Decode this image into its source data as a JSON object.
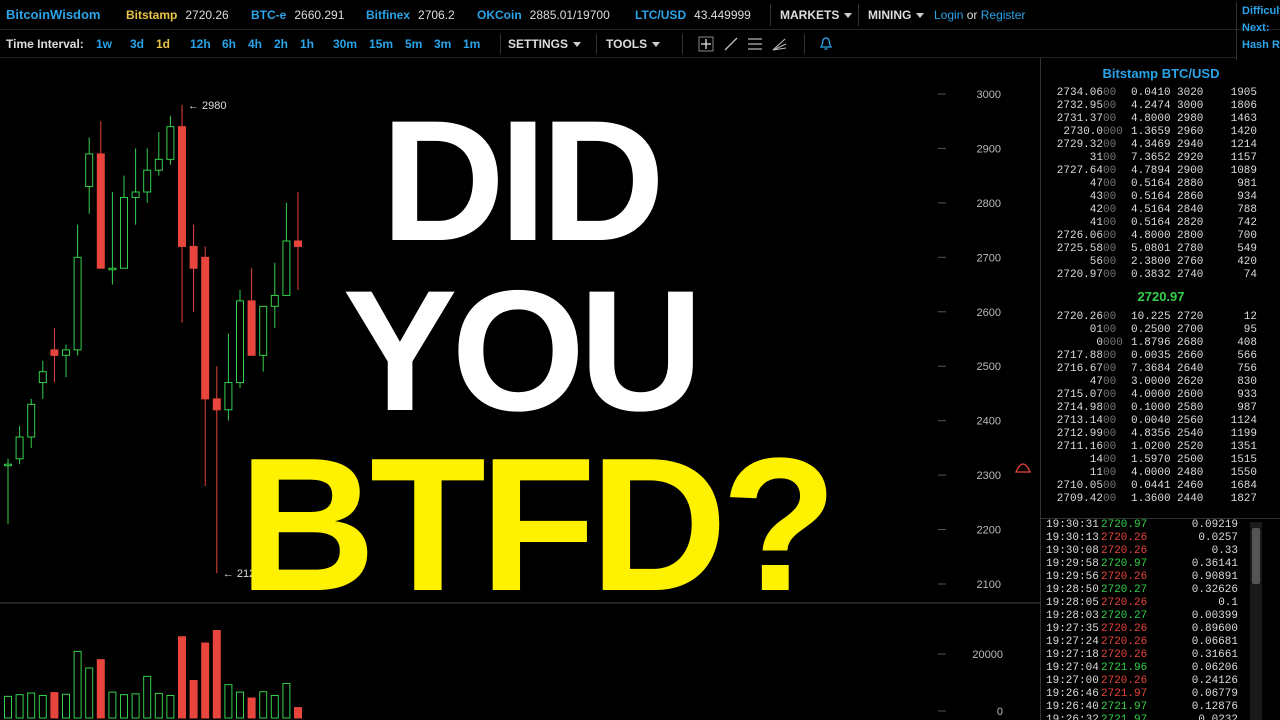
{
  "brand": "BitcoinWisdom",
  "tickers": [
    {
      "name": "Bitstamp",
      "price": "2720.26",
      "active": true
    },
    {
      "name": "BTC-e",
      "price": "2660.291"
    },
    {
      "name": "Bitfinex",
      "price": "2706.2"
    },
    {
      "name": "OKCoin",
      "price": "2885.01/19700"
    },
    {
      "name": "LTC/USD",
      "price": "43.449999"
    }
  ],
  "menus": {
    "markets": "MARKETS",
    "mining": "MINING"
  },
  "auth": {
    "login": "Login",
    "or": "or",
    "register": "Register"
  },
  "difficulty_box": [
    "Difficulty",
    "Next:",
    "Hash Rate"
  ],
  "toolbar": {
    "time_interval_label": "Time Interval:",
    "intervals": [
      "1w",
      "3d",
      "1d",
      "12h",
      "6h",
      "4h",
      "2h",
      "1h",
      "30m",
      "15m",
      "5m",
      "3m",
      "1m"
    ],
    "active_interval": "1d",
    "settings": "SETTINGS",
    "tools": "TOOLS"
  },
  "chart_data": {
    "type": "candlestick",
    "y_axis_ticks": [
      3000,
      2900,
      2800,
      2700,
      2600,
      2500,
      2400,
      2300,
      2200,
      2100
    ],
    "ylim": [
      2050,
      3040
    ],
    "annotations": [
      {
        "label": "← 2980",
        "value": 2980
      },
      {
        "label": "← 2120",
        "value": 2120
      }
    ],
    "candles": [
      {
        "o": 2320,
        "h": 2330,
        "l": 2210,
        "c": 2320
      },
      {
        "o": 2330,
        "h": 2390,
        "l": 2320,
        "c": 2370
      },
      {
        "o": 2370,
        "h": 2440,
        "l": 2350,
        "c": 2430
      },
      {
        "o": 2470,
        "h": 2510,
        "l": 2440,
        "c": 2490
      },
      {
        "o": 2530,
        "h": 2570,
        "l": 2470,
        "c": 2520
      },
      {
        "o": 2520,
        "h": 2540,
        "l": 2480,
        "c": 2530
      },
      {
        "o": 2530,
        "h": 2760,
        "l": 2520,
        "c": 2700
      },
      {
        "o": 2830,
        "h": 2920,
        "l": 2780,
        "c": 2890
      },
      {
        "o": 2890,
        "h": 2950,
        "l": 2690,
        "c": 2680
      },
      {
        "o": 2680,
        "h": 2820,
        "l": 2650,
        "c": 2680
      },
      {
        "o": 2680,
        "h": 2850,
        "l": 2680,
        "c": 2810
      },
      {
        "o": 2810,
        "h": 2900,
        "l": 2760,
        "c": 2820
      },
      {
        "o": 2820,
        "h": 2900,
        "l": 2800,
        "c": 2860
      },
      {
        "o": 2860,
        "h": 2930,
        "l": 2850,
        "c": 2880
      },
      {
        "o": 2880,
        "h": 2960,
        "l": 2870,
        "c": 2940
      },
      {
        "o": 2940,
        "h": 2980,
        "l": 2580,
        "c": 2720
      },
      {
        "o": 2720,
        "h": 2760,
        "l": 2600,
        "c": 2680
      },
      {
        "o": 2700,
        "h": 2720,
        "l": 2280,
        "c": 2440
      },
      {
        "o": 2440,
        "h": 2500,
        "l": 2120,
        "c": 2420
      },
      {
        "o": 2420,
        "h": 2560,
        "l": 2400,
        "c": 2470
      },
      {
        "o": 2470,
        "h": 2640,
        "l": 2460,
        "c": 2620
      },
      {
        "o": 2620,
        "h": 2680,
        "l": 2540,
        "c": 2520
      },
      {
        "o": 2520,
        "h": 2600,
        "l": 2490,
        "c": 2610
      },
      {
        "o": 2610,
        "h": 2690,
        "l": 2570,
        "c": 2630
      },
      {
        "o": 2630,
        "h": 2800,
        "l": 2630,
        "c": 2730
      },
      {
        "o": 2730,
        "h": 2820,
        "l": 2640,
        "c": 2720
      }
    ],
    "volume_axis_ticks": [
      20000,
      0
    ],
    "volume": [
      {
        "v": 5200,
        "up": true
      },
      {
        "v": 5600,
        "up": true
      },
      {
        "v": 6000,
        "up": true
      },
      {
        "v": 5400,
        "up": true
      },
      {
        "v": 6100,
        "up": false
      },
      {
        "v": 5700,
        "up": true
      },
      {
        "v": 16000,
        "up": true
      },
      {
        "v": 12000,
        "up": true
      },
      {
        "v": 14000,
        "up": false
      },
      {
        "v": 6200,
        "up": true
      },
      {
        "v": 5600,
        "up": true
      },
      {
        "v": 5800,
        "up": true
      },
      {
        "v": 10000,
        "up": true
      },
      {
        "v": 5900,
        "up": true
      },
      {
        "v": 5400,
        "up": true
      },
      {
        "v": 19500,
        "up": false
      },
      {
        "v": 9000,
        "up": false
      },
      {
        "v": 18000,
        "up": false
      },
      {
        "v": 21000,
        "up": false
      },
      {
        "v": 8000,
        "up": true
      },
      {
        "v": 6200,
        "up": true
      },
      {
        "v": 4800,
        "up": false
      },
      {
        "v": 6300,
        "up": true
      },
      {
        "v": 5400,
        "up": true
      },
      {
        "v": 8300,
        "up": true
      },
      {
        "v": 2500,
        "up": false
      }
    ],
    "vlim": [
      0,
      24000
    ]
  },
  "overlay": {
    "line1": "DID",
    "line2": "YOU",
    "line3": "BTFD?"
  },
  "orderbook": {
    "title": "Bitstamp BTC/USD",
    "last_price": "2720.97",
    "asks": [
      [
        "2734.06",
        "00",
        "0.0410",
        "3020",
        "1905"
      ],
      [
        "2732.95",
        "00",
        "4.2474",
        "3000",
        "1806"
      ],
      [
        "2731.37",
        "00",
        "4.8000",
        "2980",
        "1463"
      ],
      [
        "2730.0",
        "000",
        "1.3659",
        "2960",
        "1420"
      ],
      [
        "2729.32",
        "00",
        "4.3469",
        "2940",
        "1214"
      ],
      [
        "31",
        "00",
        "7.3652",
        "2920",
        "1157"
      ],
      [
        "2727.64",
        "00",
        "4.7894",
        "2900",
        "1089"
      ],
      [
        "47",
        "00",
        "0.5164",
        "2880",
        "981"
      ],
      [
        "43",
        "00",
        "0.5164",
        "2860",
        "934"
      ],
      [
        "42",
        "00",
        "4.5164",
        "2840",
        "788"
      ],
      [
        "41",
        "00",
        "0.5164",
        "2820",
        "742"
      ],
      [
        "2726.06",
        "00",
        "4.8000",
        "2800",
        "700"
      ],
      [
        "2725.58",
        "00",
        "5.0801",
        "2780",
        "549"
      ],
      [
        "56",
        "00",
        "2.3800",
        "2760",
        "420"
      ],
      [
        "2720.97",
        "00",
        "0.3832",
        "2740",
        "74"
      ]
    ],
    "bids": [
      [
        "2720.26",
        "00",
        "10.225",
        "2720",
        "12"
      ],
      [
        "01",
        "00",
        "0.2500",
        "2700",
        "95"
      ],
      [
        "0",
        "000",
        "1.8796",
        "2680",
        "408"
      ],
      [
        "2717.88",
        "00",
        "0.0035",
        "2660",
        "566"
      ],
      [
        "2716.67",
        "00",
        "7.3684",
        "2640",
        "756"
      ],
      [
        "47",
        "00",
        "3.0000",
        "2620",
        "830"
      ],
      [
        "2715.07",
        "00",
        "4.0000",
        "2600",
        "933"
      ],
      [
        "2714.98",
        "00",
        "0.1000",
        "2580",
        "987"
      ],
      [
        "2713.14",
        "00",
        "0.0040",
        "2560",
        "1124"
      ],
      [
        "2712.99",
        "00",
        "4.8356",
        "2540",
        "1199"
      ],
      [
        "2711.16",
        "00",
        "1.0200",
        "2520",
        "1351"
      ],
      [
        "14",
        "00",
        "1.5970",
        "2500",
        "1515"
      ],
      [
        "11",
        "00",
        "4.0000",
        "2480",
        "1550"
      ],
      [
        "2710.05",
        "00",
        "0.0441",
        "2460",
        "1684"
      ],
      [
        "2709.42",
        "00",
        "1.3600",
        "2440",
        "1827"
      ]
    ]
  },
  "trades": [
    {
      "time": "19:30:31",
      "price": "2720.97",
      "dir": "up",
      "amount": "0.09219"
    },
    {
      "time": "19:30:13",
      "price": "2720.26",
      "dir": "dn",
      "amount": "0.0257"
    },
    {
      "time": "19:30:08",
      "price": "2720.26",
      "dir": "dn",
      "amount": "0.33"
    },
    {
      "time": "19:29:58",
      "price": "2720.97",
      "dir": "up",
      "amount": "0.36141"
    },
    {
      "time": "19:29:56",
      "price": "2720.26",
      "dir": "dn",
      "amount": "0.90891"
    },
    {
      "time": "19:28:50",
      "price": "2720.27",
      "dir": "up",
      "amount": "0.32626"
    },
    {
      "time": "19:28:05",
      "price": "2720.26",
      "dir": "dn",
      "amount": "0.1"
    },
    {
      "time": "19:28:03",
      "price": "2720.27",
      "dir": "up",
      "amount": "0.00399"
    },
    {
      "time": "19:27:35",
      "price": "2720.26",
      "dir": "dn",
      "amount": "0.89600"
    },
    {
      "time": "19:27:24",
      "price": "2720.26",
      "dir": "dn",
      "amount": "0.06681"
    },
    {
      "time": "19:27:18",
      "price": "2720.26",
      "dir": "dn",
      "amount": "0.31661"
    },
    {
      "time": "19:27:04",
      "price": "2721.96",
      "dir": "up",
      "amount": "0.06206"
    },
    {
      "time": "19:27:00",
      "price": "2720.26",
      "dir": "dn",
      "amount": "0.24126"
    },
    {
      "time": "19:26:46",
      "price": "2721.97",
      "dir": "dn",
      "amount": "0.06779"
    },
    {
      "time": "19:26:40",
      "price": "2721.97",
      "dir": "up",
      "amount": "0.12876"
    },
    {
      "time": "19:26:32",
      "price": "2721.97",
      "dir": "up",
      "amount": "0.0232"
    }
  ],
  "colors": {
    "up": "#35d04a",
    "down": "#e8453c",
    "accent": "#2aa3e8",
    "active": "#e8c34a",
    "overlay_yellow": "#fff200"
  },
  "icons": [
    "crosshair-icon",
    "line-tool-icon",
    "fib-tool-icon",
    "fan-tool-icon",
    "alarm-bell-icon",
    "price-alert-icon"
  ]
}
